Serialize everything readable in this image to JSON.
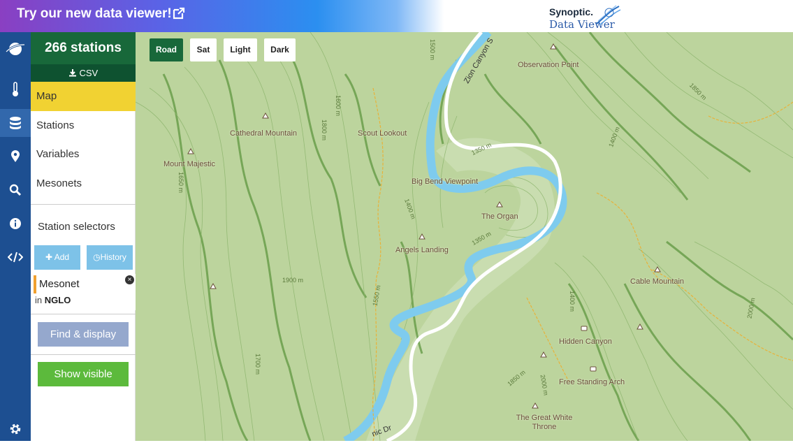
{
  "banner": {
    "promo": "Try our new data viewer!",
    "logo_line1": "Synoptic.",
    "logo_line2": "Data Viewer"
  },
  "iconbar": {
    "items": [
      "globe-icon",
      "thermometer-icon",
      "database-icon",
      "map-marker-icon",
      "search-icon",
      "info-icon",
      "code-icon",
      "gear-icon"
    ]
  },
  "sidebar": {
    "station_count": "266 stations",
    "csv_label": "CSV",
    "nav": [
      "Map",
      "Stations",
      "Variables",
      "Mesonets"
    ],
    "selectors_title": "Station selectors",
    "add_label": "Add",
    "history_label": "History",
    "chip": {
      "name": "Mesonet",
      "in_label": "in",
      "value": "NGLO"
    },
    "find_label": "Find & display",
    "show_label": "Show visible"
  },
  "map": {
    "types": [
      "Road",
      "Sat",
      "Light",
      "Dark"
    ],
    "active_type": "Road",
    "places": [
      "Observation Point",
      "Cathedral Mountain",
      "Scout Lookout",
      "Mount Majestic",
      "Big Bend Viewpoint",
      "The Organ",
      "Angels Landing",
      "Cable Mountain",
      "Hidden Canyon",
      "Free Standing Arch",
      "The Great White Throne"
    ],
    "road_labels": [
      "Zion Canyon S",
      "nic Dr"
    ],
    "elevations": [
      "1350 m",
      "1500 m",
      "1800 m",
      "1650 m",
      "1400 m",
      "1900 m",
      "1850 m",
      "2000 m",
      "1700 m",
      "1600 m",
      "1550 m"
    ]
  },
  "colors": {
    "brand_green": "#18683a",
    "nav_active": "#f1d232",
    "iconbar": "#1d4f91",
    "river": "#7ecbee",
    "terrain": "#bcd49d"
  }
}
